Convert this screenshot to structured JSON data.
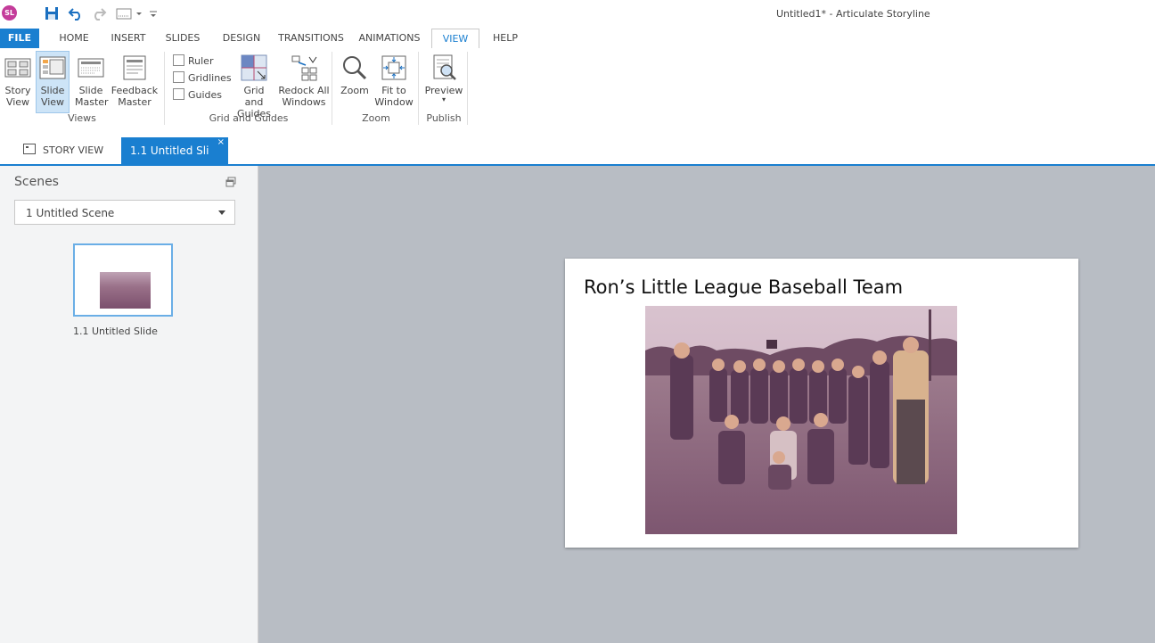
{
  "app": {
    "logo_text": "SL",
    "window_title": "Untitled1* -  Articulate Storyline"
  },
  "ribbon_tabs": [
    "FILE",
    "HOME",
    "INSERT",
    "SLIDES",
    "DESIGN",
    "TRANSITIONS",
    "ANIMATIONS",
    "VIEW",
    "HELP"
  ],
  "active_tab": "VIEW",
  "ribbon": {
    "views": {
      "group_label": "Views",
      "story_view": [
        "Story",
        "View"
      ],
      "slide_view": [
        "Slide",
        "View"
      ],
      "slide_master": [
        "Slide",
        "Master"
      ],
      "feedback_master": [
        "Feedback",
        "Master"
      ]
    },
    "grid": {
      "group_label": "Grid and Guides",
      "ruler": "Ruler",
      "gridlines": "Gridlines",
      "guides": "Guides",
      "grid_and_guides": [
        "Grid and",
        "Guides"
      ],
      "redock": [
        "Redock All",
        "Windows"
      ]
    },
    "zoom": {
      "group_label": "Zoom",
      "zoom": "Zoom",
      "fit_window": [
        "Fit to",
        "Window"
      ]
    },
    "publish": {
      "group_label": "Publish",
      "preview": "Preview",
      "preview_arrow": "▾"
    }
  },
  "doc_tabs": {
    "story_view": "STORY VIEW",
    "slide": "1.1 Untitled Sli",
    "close": "×"
  },
  "scenes": {
    "title": "Scenes",
    "selected_scene": "1 Untitled Scene",
    "thumbnail_label": "1.1 Untitled Slide"
  },
  "slide": {
    "title": "Ron’s Little League Baseball Team"
  },
  "colors": {
    "accent": "#1a7fd0",
    "canvas_bg": "#b8bdc4",
    "panel_bg": "#f3f4f5"
  }
}
